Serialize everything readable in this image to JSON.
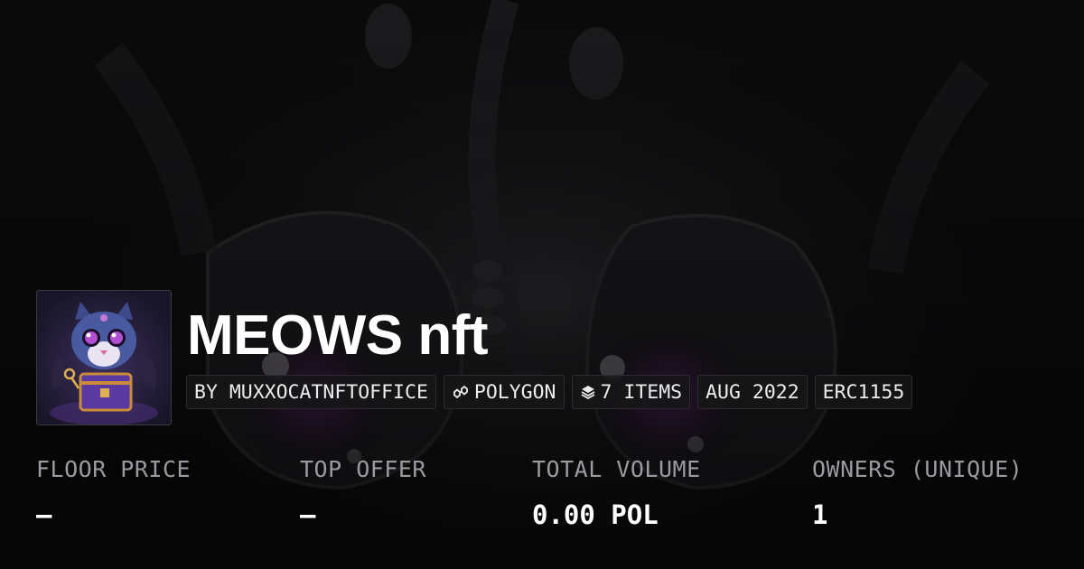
{
  "collection": {
    "name": "MEOWS nft",
    "avatar_alt": "MEOWS nft collection avatar"
  },
  "tags": [
    {
      "label": "BY MUXXOCATNFTOFFICE",
      "icon": ""
    },
    {
      "label": "POLYGON",
      "icon": "polygon-chain-icon"
    },
    {
      "label": "7 ITEMS",
      "icon": "layers-icon"
    },
    {
      "label": "AUG 2022",
      "icon": ""
    },
    {
      "label": "ERC1155",
      "icon": ""
    }
  ],
  "stats": [
    {
      "label": "FLOOR PRICE",
      "value": "—"
    },
    {
      "label": "TOP OFFER",
      "value": "—"
    },
    {
      "label": "TOTAL VOLUME",
      "value": "0.00 POL"
    },
    {
      "label": "OWNERS (UNIQUE)",
      "value": "1"
    }
  ],
  "colors": {
    "background": "#0b0b0c",
    "text_primary": "#ffffff",
    "text_secondary": "#9a9aa0",
    "tag_border": "#2c2c30",
    "accent_purple": "#7b3fb5"
  }
}
